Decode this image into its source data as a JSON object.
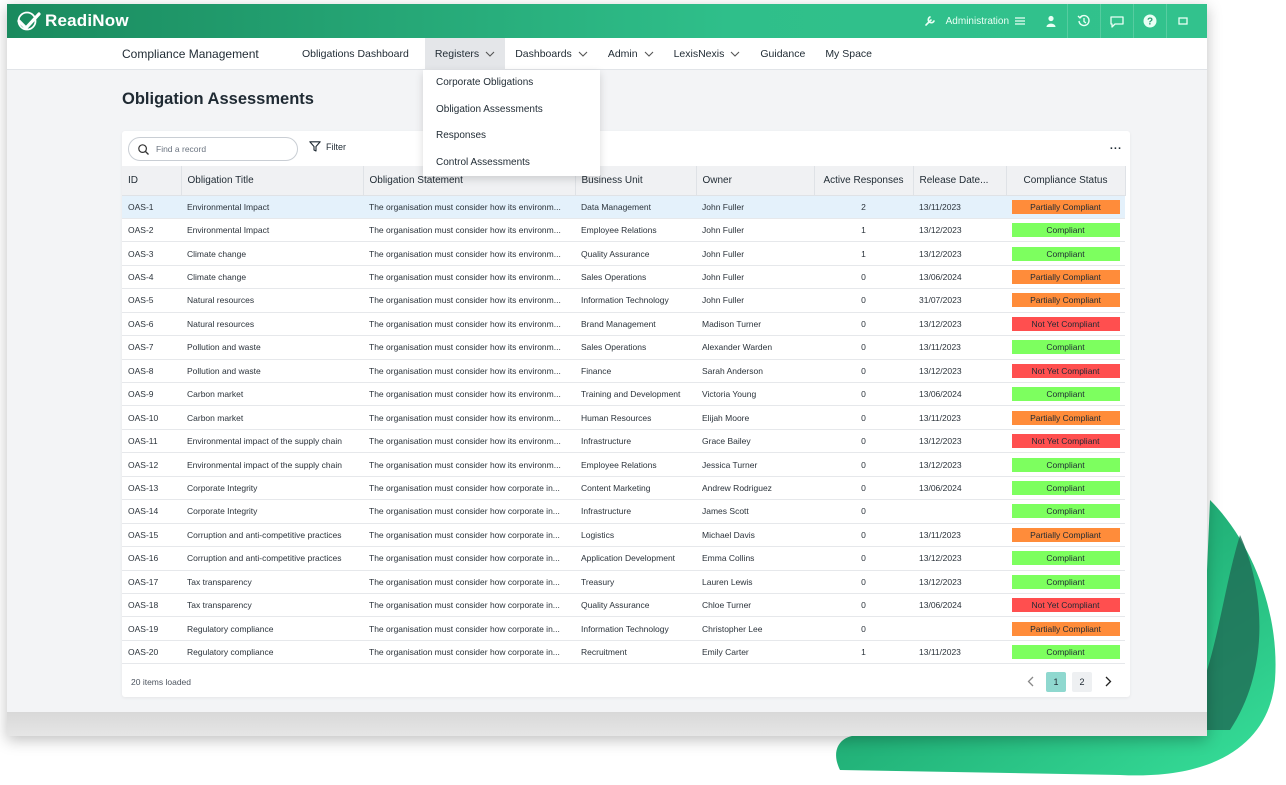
{
  "app": {
    "logo_text": "ReadiNow",
    "admin_label": "Administration"
  },
  "colors": {
    "brand_green": "#2fbf8a",
    "partially_compliant": "#ff8c3a",
    "compliant": "#7dff5f",
    "not_yet_compliant": "#ff4f4f",
    "selected_row": "#e4f1fb"
  },
  "topbar_icons": [
    "wrench-icon",
    "menu-icon",
    "user-icon",
    "history-icon",
    "chat-icon",
    "help-icon",
    "expand-icon"
  ],
  "nav": {
    "brand": "Compliance Management",
    "items": [
      {
        "label": "Obligations Dashboard",
        "chevron": false
      },
      {
        "label": "Registers",
        "chevron": true
      },
      {
        "label": "Dashboards",
        "chevron": true
      },
      {
        "label": "Admin",
        "chevron": true
      },
      {
        "label": "LexisNexis",
        "chevron": true
      },
      {
        "label": "Guidance",
        "chevron": false
      },
      {
        "label": "My Space",
        "chevron": false
      }
    ]
  },
  "dropdown": {
    "items": [
      "Corporate Obligations",
      "Obligation Assessments",
      "Responses",
      "Control Assessments"
    ]
  },
  "page": {
    "title": "Obligation Assessments"
  },
  "toolbar": {
    "search_placeholder": "Find a record",
    "filter_label": "Filter",
    "more_label": "..."
  },
  "table": {
    "columns": [
      "ID",
      "Obligation Title",
      "Obligation Statement",
      "Business Unit",
      "Owner",
      "Active Responses",
      "Release Date...",
      "Compliance Status"
    ],
    "rows": [
      [
        "OAS-1",
        "Environmental Impact",
        "The organisation must consider how its environm...",
        "Data Management",
        "John Fuller",
        "2",
        "13/11/2023",
        "Partially Compliant"
      ],
      [
        "OAS-2",
        "Environmental Impact",
        "The organisation must consider how its environm...",
        "Employee Relations",
        "John Fuller",
        "1",
        "13/12/2023",
        "Compliant"
      ],
      [
        "OAS-3",
        "Climate change",
        "The organisation must consider how its environm...",
        "Quality Assurance",
        "John Fuller",
        "1",
        "13/12/2023",
        "Compliant"
      ],
      [
        "OAS-4",
        "Climate change",
        "The organisation must consider how its environm...",
        "Sales Operations",
        "John Fuller",
        "0",
        "13/06/2024",
        "Partially Compliant"
      ],
      [
        "OAS-5",
        "Natural resources",
        "The organisation must consider how its environm...",
        "Information Technology",
        "John Fuller",
        "0",
        "31/07/2023",
        "Partially Compliant"
      ],
      [
        "OAS-6",
        "Natural resources",
        "The organisation must consider how its environm...",
        "Brand Management",
        "Madison Turner",
        "0",
        "13/12/2023",
        "Not Yet Compliant"
      ],
      [
        "OAS-7",
        "Pollution and waste",
        "The organisation must consider how its environm...",
        "Sales Operations",
        "Alexander Warden",
        "0",
        "13/11/2023",
        "Compliant"
      ],
      [
        "OAS-8",
        "Pollution and waste",
        "The organisation must consider how its environm...",
        "Finance",
        "Sarah Anderson",
        "0",
        "13/12/2023",
        "Not Yet Compliant"
      ],
      [
        "OAS-9",
        "Carbon market",
        "The organisation must consider how its environm...",
        "Training and Development",
        "Victoria Young",
        "0",
        "13/06/2024",
        "Compliant"
      ],
      [
        "OAS-10",
        "Carbon market",
        "The organisation must consider how its environm...",
        "Human Resources",
        "Elijah Moore",
        "0",
        "13/11/2023",
        "Partially Compliant"
      ],
      [
        "OAS-11",
        "Environmental impact of the supply chain",
        "The organisation must consider how its environm...",
        "Infrastructure",
        "Grace Bailey",
        "0",
        "13/12/2023",
        "Not Yet Compliant"
      ],
      [
        "OAS-12",
        "Environmental impact of the supply chain",
        "The organisation must consider how its environm...",
        "Employee Relations",
        "Jessica Turner",
        "0",
        "13/12/2023",
        "Compliant"
      ],
      [
        "OAS-13",
        "Corporate Integrity",
        "The organisation must consider how corporate in...",
        "Content Marketing",
        "Andrew Rodriguez",
        "0",
        "13/06/2024",
        "Compliant"
      ],
      [
        "OAS-14",
        "Corporate Integrity",
        "The organisation must consider how corporate in...",
        "Infrastructure",
        "James Scott",
        "0",
        "",
        "Compliant"
      ],
      [
        "OAS-15",
        "Corruption and anti-competitive practices",
        "The organisation must consider how corporate in...",
        "Logistics",
        "Michael Davis",
        "0",
        "13/11/2023",
        "Partially Compliant"
      ],
      [
        "OAS-16",
        "Corruption and anti-competitive practices",
        "The organisation must consider how corporate in...",
        "Application Development",
        "Emma Collins",
        "0",
        "13/12/2023",
        "Compliant"
      ],
      [
        "OAS-17",
        "Tax transparency",
        "The organisation must consider how corporate in...",
        "Treasury",
        "Lauren Lewis",
        "0",
        "13/12/2023",
        "Compliant"
      ],
      [
        "OAS-18",
        "Tax transparency",
        "The organisation must consider how corporate in...",
        "Quality Assurance",
        "Chloe Turner",
        "0",
        "13/06/2024",
        "Not Yet Compliant"
      ],
      [
        "OAS-19",
        "Regulatory compliance",
        "The organisation must consider how corporate in...",
        "Information Technology",
        "Christopher Lee",
        "0",
        "",
        "Partially Compliant"
      ],
      [
        "OAS-20",
        "Regulatory compliance",
        "The organisation must consider how corporate in...",
        "Recruitment",
        "Emily Carter",
        "1",
        "13/11/2023",
        "Compliant"
      ]
    ]
  },
  "footer": {
    "items_loaded": "20 items loaded",
    "pages": [
      "1",
      "2"
    ],
    "current_page": "1"
  }
}
